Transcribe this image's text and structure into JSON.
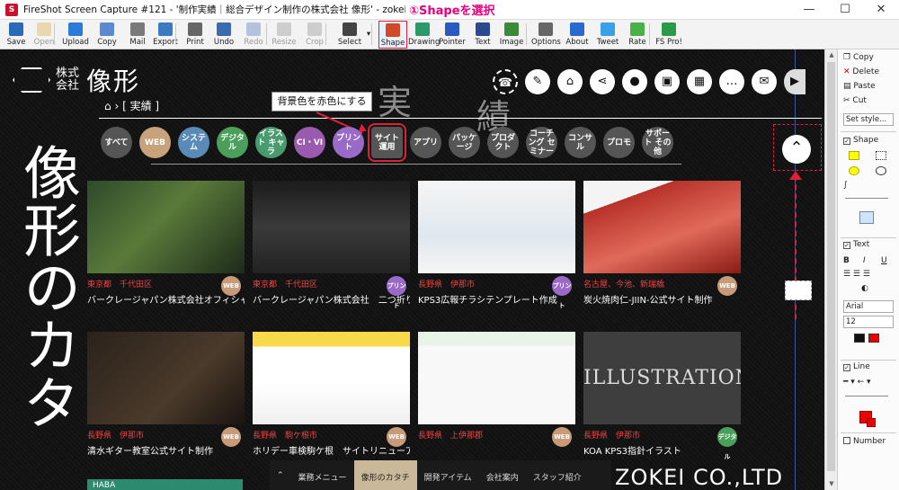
{
  "window": {
    "title": "FireShot Screen Capture #121 - '制作実績｜総合デザイン制作の株式会社 像形' - zokei_co_jp_performance_ht",
    "annotation": "①Shapeを選択",
    "controls": [
      "—",
      "☐",
      "✕"
    ]
  },
  "toolbar": [
    {
      "label": "Save",
      "icon": "save-icon",
      "color": "#2a6bb8",
      "enabled": true
    },
    {
      "label": "Open",
      "icon": "open-icon",
      "color": "#d9a32a",
      "enabled": false
    },
    {
      "label": "Upload",
      "icon": "upload-icon",
      "color": "#2a7bd8",
      "enabled": true
    },
    {
      "label": "Copy",
      "icon": "copy-icon",
      "color": "#5a8ad0",
      "enabled": true
    },
    {
      "label": "Mail",
      "icon": "mail-icon",
      "color": "#7a7a7a",
      "enabled": true
    },
    {
      "label": "Export",
      "icon": "export-icon",
      "color": "#3a7ac0",
      "enabled": true
    },
    {
      "label": "Print",
      "icon": "print-icon",
      "color": "#666666",
      "enabled": true
    },
    {
      "label": "Undo",
      "icon": "undo-icon",
      "color": "#3a6ab0",
      "enabled": true
    },
    {
      "label": "Redo",
      "icon": "redo-icon",
      "color": "#3a6ab0",
      "enabled": false
    },
    {
      "label": "Resize",
      "icon": "resize-icon",
      "color": "#888888",
      "enabled": false
    },
    {
      "label": "Crop",
      "icon": "crop-icon",
      "color": "#888888",
      "enabled": false
    },
    {
      "label": "Select",
      "icon": "select-icon",
      "color": "#444444",
      "enabled": true
    },
    {
      "label": "Shape",
      "icon": "shape-icon",
      "color": "#d04a2a",
      "enabled": true,
      "selected": true
    },
    {
      "label": "Drawing",
      "icon": "drawing-icon",
      "color": "#2a9a6a",
      "enabled": true
    },
    {
      "label": "Pointer",
      "icon": "pointer-icon",
      "color": "#2a5ac0",
      "enabled": true
    },
    {
      "label": "Text",
      "icon": "text-icon",
      "color": "#2a4a90",
      "enabled": true
    },
    {
      "label": "Image",
      "icon": "image-icon",
      "color": "#3a8a3a",
      "enabled": true
    },
    {
      "label": "Options",
      "icon": "options-icon",
      "color": "#666666",
      "enabled": true
    },
    {
      "label": "About",
      "icon": "about-icon",
      "color": "#2a6ad0",
      "enabled": true
    },
    {
      "label": "Tweet",
      "icon": "tweet-icon",
      "color": "#3aa0e8",
      "enabled": true
    },
    {
      "label": "Rate",
      "icon": "rate-icon",
      "color": "#4ab04a",
      "enabled": true
    },
    {
      "label": "FS Pro!",
      "icon": "fs-pro-icon",
      "color": "#2a9a4a",
      "enabled": true
    }
  ],
  "page": {
    "logo": {
      "kaisha": "株式会社",
      "name": "像形"
    },
    "header_icons": [
      "phone-icon",
      "pen-icon",
      "home-icon",
      "share-icon",
      "location-icon",
      "briefcase-icon",
      "calendar-icon",
      "chat-icon",
      "mail-icon",
      "play-icon"
    ],
    "big_kanji": [
      "実",
      "績"
    ],
    "breadcrumb": {
      "home_icon": "⌂",
      "sep": "›",
      "current": "[ 実績 ]"
    },
    "annotation": "背景色を赤色にする",
    "categories": [
      {
        "label": "すべて",
        "color": "#555555"
      },
      {
        "label": "WEB",
        "color": "#c8a27a"
      },
      {
        "label": "システム",
        "color": "#5a8ab8"
      },
      {
        "label": "デジタル",
        "color": "#4aa05a"
      },
      {
        "label": "イラスト キャラ",
        "color": "#4a9a70"
      },
      {
        "label": "CI・VI",
        "color": "#9a5ab0"
      },
      {
        "label": "プリント",
        "color": "#9a6ac8"
      },
      {
        "label": "サイト 運用",
        "color": "#555555",
        "selected": true
      },
      {
        "label": "アプリ",
        "color": "#555555"
      },
      {
        "label": "パッケージ",
        "color": "#555555"
      },
      {
        "label": "プロダクト",
        "color": "#555555"
      },
      {
        "label": "コーチング セミナー",
        "color": "#555555"
      },
      {
        "label": "コンサル",
        "color": "#555555"
      },
      {
        "label": "プロモ",
        "color": "#555555"
      },
      {
        "label": "サポート その他",
        "color": "#555555"
      }
    ],
    "vertical_text": "像形のカタ",
    "cards": [
      {
        "location": "東京都　千代田区",
        "title": "バークレージャパン株式会社オフィシャル",
        "badge": "WEB",
        "badge_color": "#c89a78"
      },
      {
        "location": "東京都　千代田区",
        "title": "バークレージャパン株式会社　二つ折りス",
        "badge": "プリント",
        "badge_color": "#9a6ac8"
      },
      {
        "location": "長野県　伊那市",
        "title": "KPS3広報チラシテンプレート作成",
        "badge": "プリント",
        "badge_color": "#9a6ac8"
      },
      {
        "location": "名古屋、今池、新瑞橋",
        "title": "炭火焼肉仁-JIIN-公式サイト制作",
        "badge": "WEB",
        "badge_color": "#c89a78"
      },
      {
        "location": "長野県　伊那市",
        "title": "清水ギター教室公式サイト制作",
        "badge": "WEB",
        "badge_color": "#c89a78"
      },
      {
        "location": "長野県　駒ケ根市",
        "title": "ホリデー車検駒ケ根　サイトリニューアル",
        "badge": "WEB",
        "badge_color": "#c89a78"
      },
      {
        "location": "長野県　上伊那郡",
        "title": "",
        "badge": "WEB",
        "badge_color": "#c89a78"
      },
      {
        "location": "長野県　伊那市",
        "title": "KOA KPS3指針イラスト",
        "badge": "デジタル",
        "badge_color": "#4aa05a",
        "illustration": "ILLUSTRATION"
      }
    ],
    "haba": "HABA",
    "bottom_menu": [
      "業務メニュー",
      "像形のカタチ",
      "開発アイテム",
      "会社案内",
      "スタッフ紹介"
    ],
    "brand": "ZOKEI CO.,LTD"
  },
  "panel": {
    "copy": "Copy",
    "delete": "Delete",
    "paste": "Paste",
    "cut": "Cut",
    "set_style": "Set style...",
    "shape": "Shape",
    "text": "Text",
    "bold": "B",
    "italic": "I",
    "underline": "U",
    "font": "Arial",
    "size": "12",
    "line": "Line",
    "number": "Number",
    "fill_color": "#d63a2a",
    "stroke_color": "#111111"
  }
}
